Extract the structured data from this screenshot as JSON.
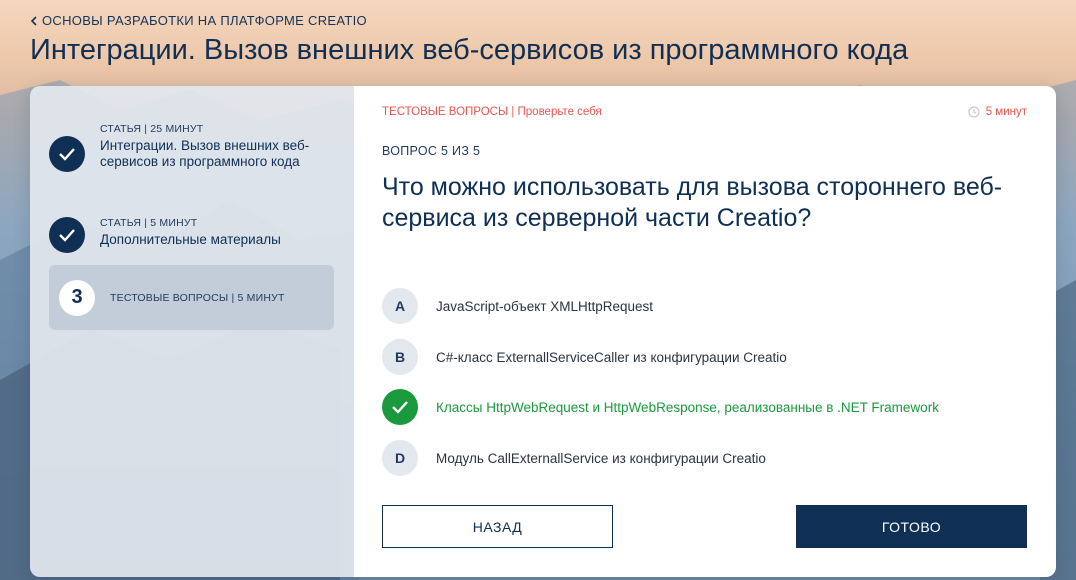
{
  "breadcrumb": {
    "label": "ОСНОВЫ РАЗРАБОТКИ НА ПЛАТФОРМЕ CREATIO",
    "icon": "chevron-left-icon"
  },
  "page_title": "Интеграции. Вызов внешних веб-сервисов из программного кода",
  "sidebar": {
    "items": [
      {
        "meta": "СТАТЬЯ | 25 МИНУТ",
        "title": "Интеграции. Вызов внешних веб-сервисов из программного кода",
        "status": "done",
        "icon": "check-icon"
      },
      {
        "meta": "СТАТЬЯ | 5 МИНУТ",
        "title": "Дополнительные материалы",
        "status": "done",
        "icon": "check-icon"
      },
      {
        "meta": "ТЕСТОВЫЕ ВОПРОСЫ | 5 МИНУТ",
        "title": "",
        "status": "current",
        "number": "3"
      }
    ]
  },
  "quiz": {
    "header": "ТЕСТОВЫЕ ВОПРОСЫ | Проверьте себя",
    "timer": "5 минут",
    "timer_icon": "clock-icon",
    "counter": "ВОПРОС 5 ИЗ 5",
    "question": "Что можно использовать для вызова стороннего веб-сервиса из серверной части Creatio?",
    "options": [
      {
        "letter": "A",
        "text": "JavaScript-объект XMLHttpRequest",
        "correct": false
      },
      {
        "letter": "B",
        "text": "C#-класс ExternallServiceCaller из конфигурации Creatio",
        "correct": false
      },
      {
        "letter": "",
        "text": "Классы HttpWebRequest и HttpWebResponse, реализованные в .NET Framework",
        "correct": true,
        "icon": "check-icon"
      },
      {
        "letter": "D",
        "text": "Модуль CallExternallService из конфигурации Creatio",
        "correct": false
      }
    ],
    "back_label": "НАЗАД",
    "done_label": "ГОТОВО"
  },
  "colors": {
    "navy": "#0f2f55",
    "accent_red": "#e8554f",
    "correct_green": "#1a9a3c"
  }
}
